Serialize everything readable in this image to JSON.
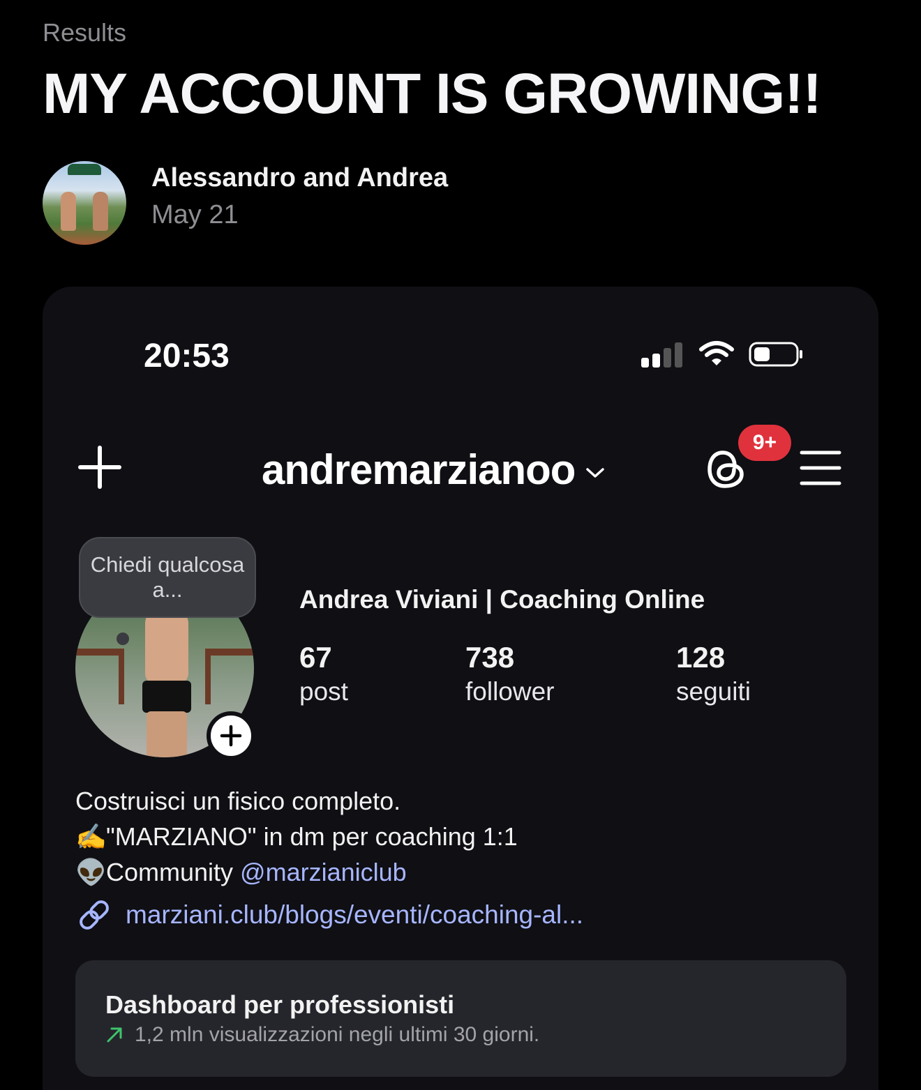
{
  "post": {
    "category": "Results",
    "title": "MY ACCOUNT IS GROWING!!",
    "author": "Alessandro and Andrea",
    "date": "May 21"
  },
  "screenshot": {
    "status_bar": {
      "time": "20:53",
      "icons": [
        "cellular-signal-icon",
        "wifi-icon",
        "battery-icon"
      ]
    },
    "header": {
      "username": "andremarzianoo",
      "notification_badge": "9+",
      "icons": [
        "plus-icon",
        "chevron-down-icon",
        "threads-icon",
        "menu-icon"
      ]
    },
    "note_bubble": "Chiedi qualcosa a...",
    "profile": {
      "display_name": "Andrea Viviani | Coaching Online",
      "stats": [
        {
          "value": "67",
          "label": "post"
        },
        {
          "value": "738",
          "label": "follower"
        },
        {
          "value": "128",
          "label": "seguiti"
        }
      ],
      "bio": {
        "line1": "Costruisci un fisico completo.",
        "line2_emoji": "✍️",
        "line2": "\"MARZIANO\" in dm per coaching 1:1",
        "line3_emoji": "👽",
        "line3_prefix": "Community ",
        "mention": "@marzianiclub"
      },
      "link": "marziani.club/blogs/eventi/coaching-al..."
    },
    "dashboard": {
      "title": "Dashboard per professionisti",
      "subtitle": "1,2 mln visualizzazioni negli ultimi 30 giorni."
    }
  },
  "colors": {
    "background": "#000000",
    "card": "#0f0f14",
    "badge": "#e0323d",
    "link": "#a7b6ff",
    "muted": "#8e8e93"
  }
}
